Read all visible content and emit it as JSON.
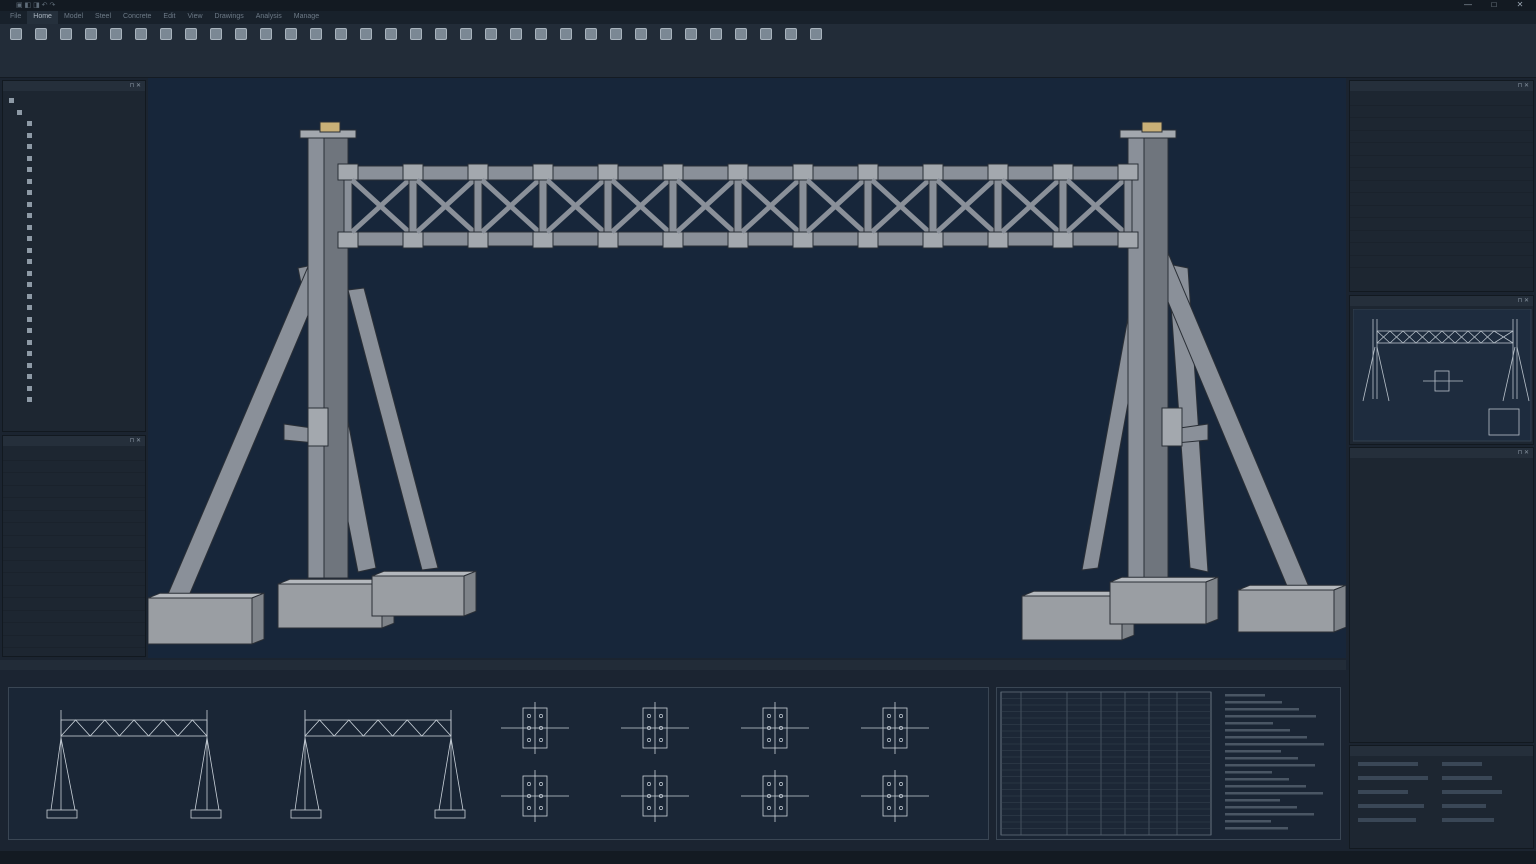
{
  "window": {
    "title": "",
    "controls": [
      "—",
      "□",
      "✕"
    ]
  },
  "menu": {
    "tabs": [
      {
        "label": "File",
        "active": false
      },
      {
        "label": "Home",
        "active": true
      },
      {
        "label": "Model",
        "active": false
      },
      {
        "label": "Steel",
        "active": false
      },
      {
        "label": "Concrete",
        "active": false
      },
      {
        "label": "Edit",
        "active": false
      },
      {
        "label": "View",
        "active": false
      },
      {
        "label": "Drawings",
        "active": false
      },
      {
        "label": "Analysis",
        "active": false
      },
      {
        "label": "Manage",
        "active": false
      }
    ]
  },
  "ribbon": {
    "tools": [
      "",
      "",
      "",
      "",
      "",
      "",
      "",
      "",
      "",
      "",
      "",
      "",
      "",
      "",
      "",
      "",
      "",
      "",
      "",
      "",
      "",
      "",
      "",
      "",
      "",
      "",
      "",
      "",
      "",
      "",
      "",
      "",
      ""
    ],
    "groups": [
      "",
      "",
      "",
      "",
      "",
      "",
      "",
      "",
      "",
      "",
      "",
      "",
      ""
    ]
  },
  "model_tree": {
    "title": "",
    "items": [
      "",
      "",
      "",
      "",
      "",
      "",
      "",
      "",
      "",
      "",
      "",
      "",
      "",
      "",
      "",
      "",
      "",
      "",
      "",
      "",
      "",
      "",
      "",
      "",
      "",
      "",
      ""
    ]
  },
  "left_properties": {
    "title": "",
    "rows": [
      {
        "key": "",
        "value": ""
      },
      {
        "key": "",
        "value": ""
      },
      {
        "key": "",
        "value": ""
      },
      {
        "key": "",
        "value": ""
      },
      {
        "key": "",
        "value": ""
      },
      {
        "key": "",
        "value": ""
      },
      {
        "key": "",
        "value": ""
      },
      {
        "key": "",
        "value": ""
      },
      {
        "key": "",
        "value": ""
      },
      {
        "key": "",
        "value": ""
      },
      {
        "key": "",
        "value": ""
      },
      {
        "key": "",
        "value": ""
      },
      {
        "key": "",
        "value": ""
      },
      {
        "key": "",
        "value": ""
      },
      {
        "key": "",
        "value": ""
      },
      {
        "key": "",
        "value": ""
      },
      {
        "key": "",
        "value": ""
      }
    ]
  },
  "right_properties": {
    "title": "",
    "rows": [
      {
        "key": "",
        "value": ""
      },
      {
        "key": "",
        "value": ""
      },
      {
        "key": "",
        "value": ""
      },
      {
        "key": "",
        "value": ""
      },
      {
        "key": "",
        "value": ""
      },
      {
        "key": "",
        "value": ""
      },
      {
        "key": "",
        "value": ""
      },
      {
        "key": "",
        "value": ""
      },
      {
        "key": "",
        "value": ""
      },
      {
        "key": "",
        "value": ""
      },
      {
        "key": "",
        "value": ""
      },
      {
        "key": "",
        "value": ""
      },
      {
        "key": "",
        "value": ""
      },
      {
        "key": "",
        "value": ""
      }
    ]
  },
  "preview": {
    "title": ""
  },
  "notes": {
    "title": "",
    "lines": [
      "",
      "",
      "",
      "",
      "",
      "",
      "",
      "",
      "",
      "",
      "",
      "",
      "",
      "",
      "",
      "",
      "",
      "",
      "",
      ""
    ]
  },
  "layers": {
    "title": ""
  },
  "viewport": {
    "label": "",
    "bg": "#17263a",
    "steel_color": "#8a9099",
    "concrete_color": "#9a9ea3"
  },
  "bottom": {
    "tab_label": "",
    "sub_label": ""
  },
  "status": {
    "text": ""
  }
}
